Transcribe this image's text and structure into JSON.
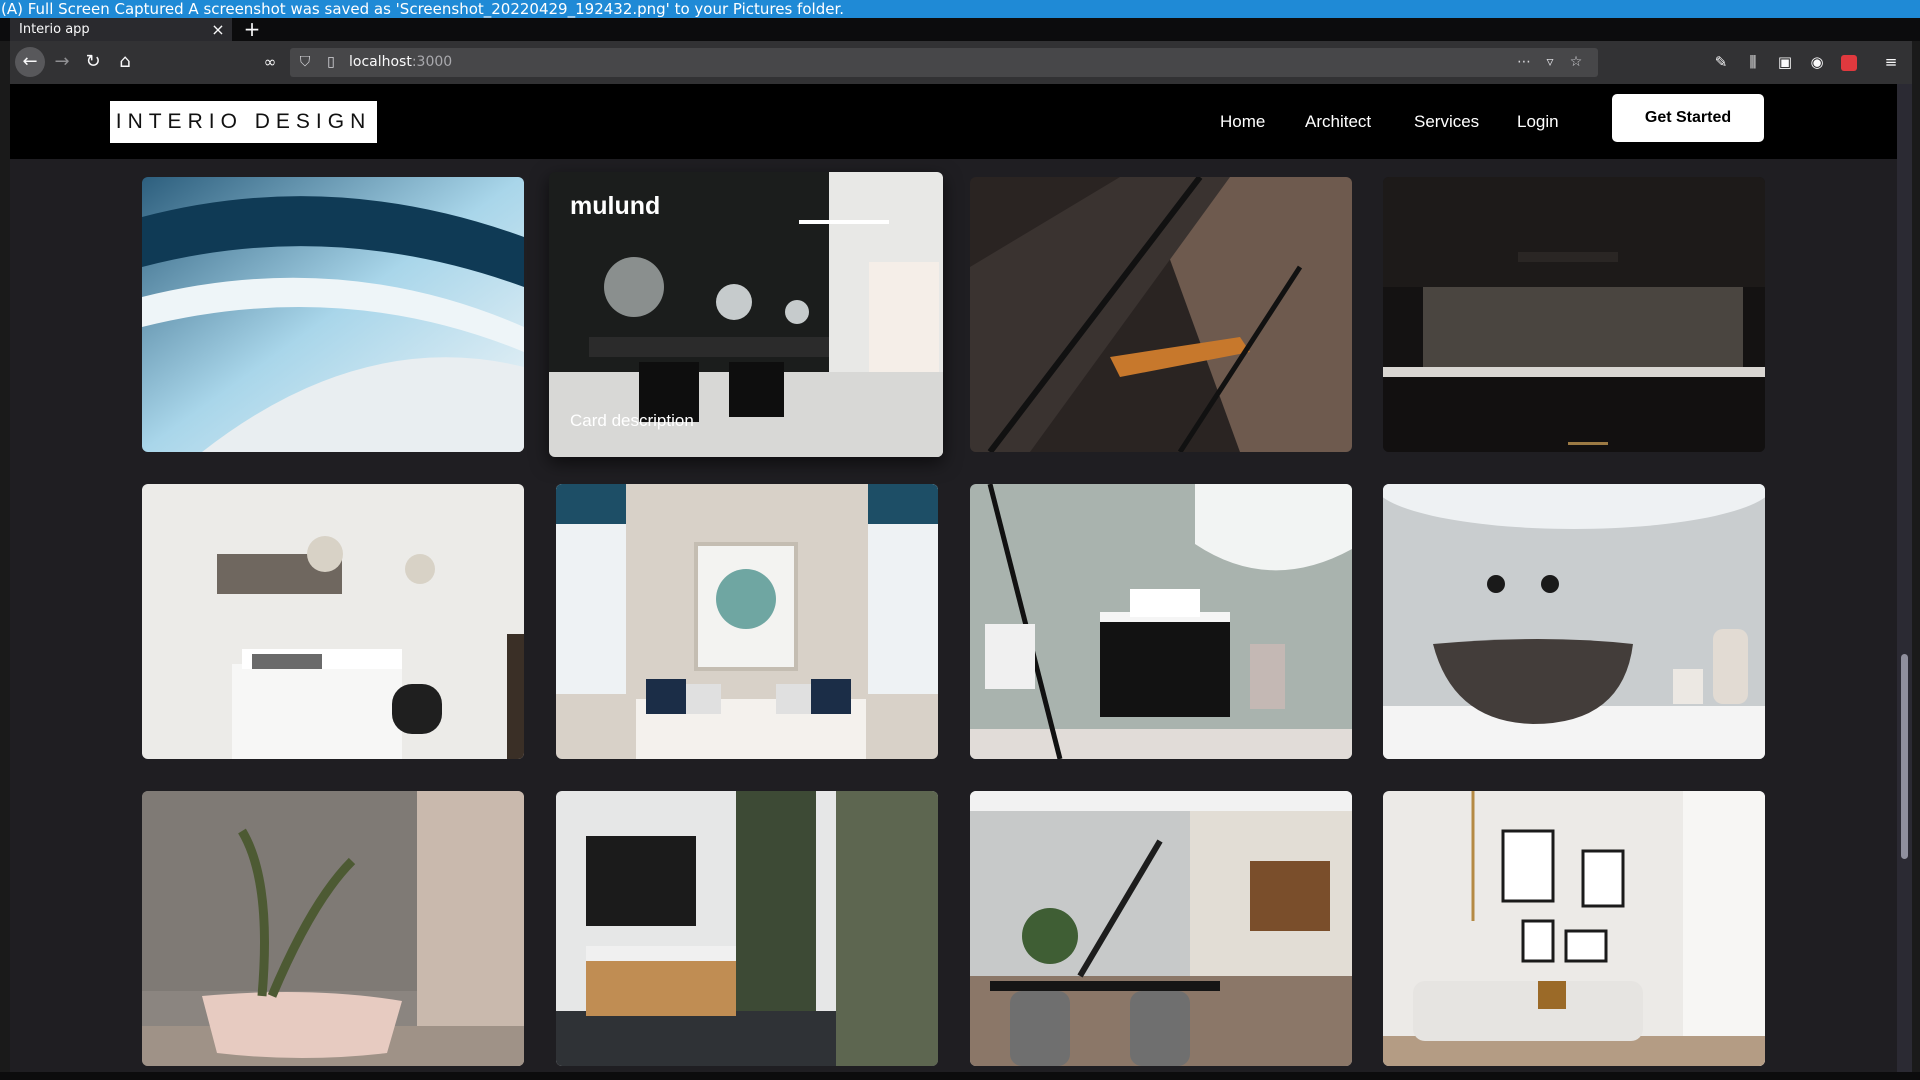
{
  "notification": {
    "text": "(A) Full Screen Captured A screenshot was saved as 'Screenshot_20220429_192432.png' to your Pictures folder."
  },
  "browser": {
    "tab_title": "Interio app",
    "tab_close": "×",
    "new_tab": "+",
    "url_host": "localhost",
    "url_port": ":3000",
    "icons": [
      "back-icon",
      "forward-icon",
      "reload-icon",
      "home-icon",
      "tracking-icon",
      "shield-icon",
      "page-icon",
      "more-icon",
      "pocket-icon",
      "bookmark-star-icon",
      "wrench-icon",
      "library-icon",
      "sidebar-icon",
      "account-icon",
      "extension-icon",
      "menu-icon"
    ]
  },
  "site": {
    "logo": "INTERIO DESIGN",
    "nav": [
      "Home",
      "Architect",
      "Services",
      "Login"
    ],
    "cta": "Get Started"
  },
  "gallery": {
    "featured_title": "mulund",
    "featured_description": "Card description"
  }
}
